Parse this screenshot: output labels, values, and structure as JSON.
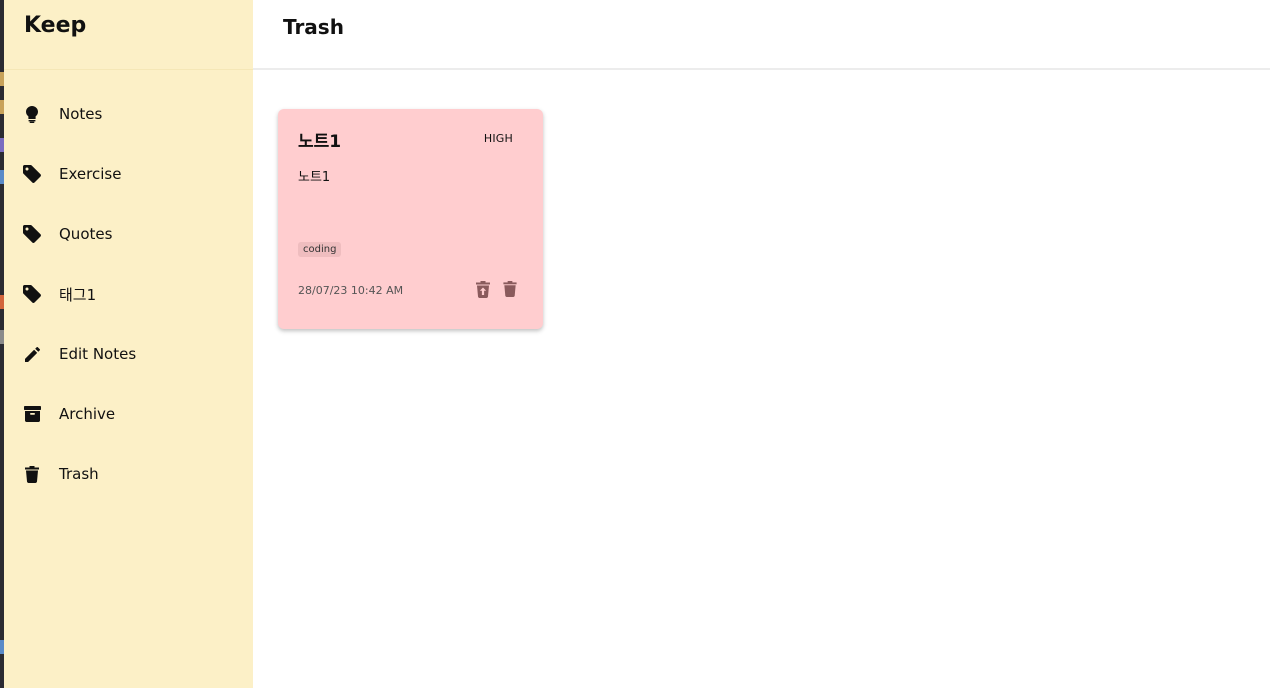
{
  "app": {
    "brand": "Keep"
  },
  "header": {
    "title": "Trash"
  },
  "sidebar": {
    "items": [
      {
        "label": "Notes",
        "icon": "lightbulb-icon"
      },
      {
        "label": "Exercise",
        "icon": "tag-icon"
      },
      {
        "label": "Quotes",
        "icon": "tag-icon"
      },
      {
        "label": "태그1",
        "icon": "tag-icon"
      },
      {
        "label": "Edit Notes",
        "icon": "pencil-icon"
      },
      {
        "label": "Archive",
        "icon": "archive-icon"
      },
      {
        "label": "Trash",
        "icon": "trash-icon"
      }
    ]
  },
  "notes": [
    {
      "title": "노트1",
      "priority": "HIGH",
      "body": "노트1",
      "tag": "coding",
      "date": "28/07/23 10:42 AM",
      "background": "#ffcdcf",
      "actions": [
        "restore-icon",
        "delete-forever-icon"
      ]
    }
  ],
  "colors": {
    "sidebar_bg": "#fcf0c7",
    "card_bg": "#ffcdcf",
    "text": "#111111"
  }
}
